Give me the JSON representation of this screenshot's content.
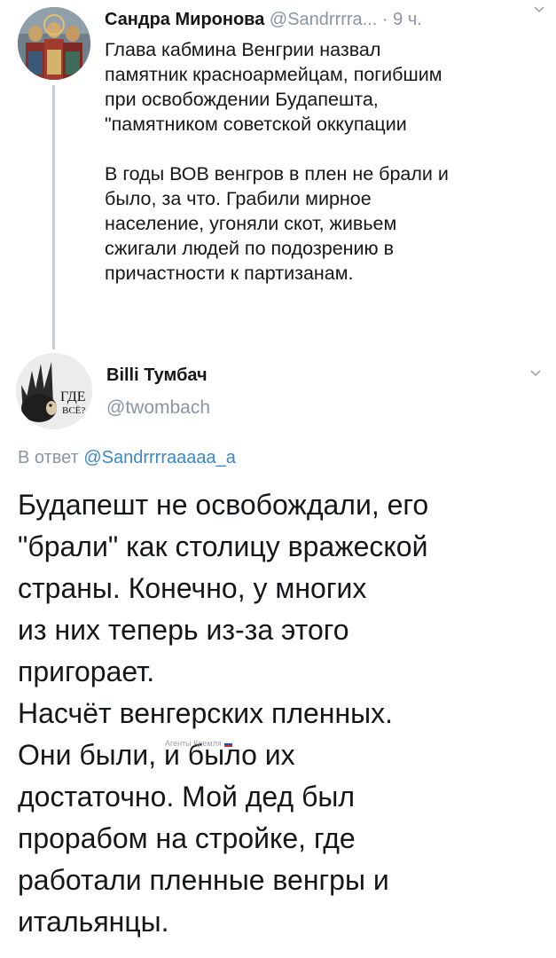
{
  "parent_tweet": {
    "author_name": "Сандра Миронова",
    "author_handle": "@Sandrrrra...",
    "separator": "·",
    "time": "9 ч.",
    "avatar_icon": "painted-icon-avatar",
    "menu_icon": "chevron-down-icon",
    "paragraphs": [
      "Глава  кабмина Венгрии назвал\nпамятник красноармейцам, погибшим\nпри освобождении Будапешта,\n\"памятником советской оккупации",
      "В годы ВОВ венгров в плен не брали и\nбыло, за что. Грабили мирное\nнаселение, угоняли скот,  живьем\nсжигали людей по подозрению в\nпричастности к партизанам."
    ]
  },
  "reply_tweet": {
    "author_name": "Billi Тумбач",
    "author_handle": "@twombach",
    "avatar_icon": "hedgehog-avatar",
    "avatar_text_line1": "ГДЕ",
    "avatar_text_line2": "ВСЁ?",
    "menu_icon": "chevron-down-icon",
    "reply_prefix": "В ответ",
    "reply_mention": "@Sandrrrraaaaa_a",
    "paragraphs": [
      "Будапешт не освобождали, его\n\"брали\" как столицу вражеской\nстраны. Конечно, у многих\nиз них теперь из-за этого\nпригорает.",
      " Насчёт венгерских пленных.\nОни были, и было их\nдостаточно. Мой дед был\nпрорабом на стройке, где\nработали пленные венгры и\nитальянцы."
    ]
  },
  "watermark": {
    "text": "Агенты Кремля",
    "flag_colors": [
      "#ffffff",
      "#1c4fd0",
      "#d52b1e"
    ]
  },
  "colors": {
    "text": "#14171a",
    "muted": "#8a96a0",
    "link": "#3a88c8",
    "thread_line": "#c8d0d6"
  }
}
